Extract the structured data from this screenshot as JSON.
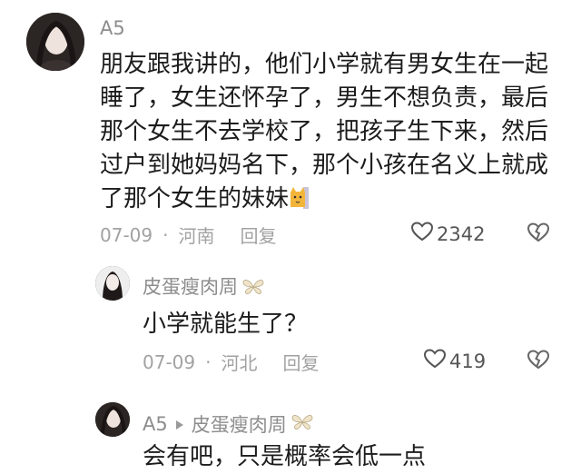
{
  "comments": [
    {
      "username": "A5",
      "text": "朋友跟我讲的，他们小学就有男女生在一起睡了，女生还怀孕了，男生不想负责，最后那个女生不去学校了，把孩子生下来，然后过户到她妈妈名下，那个小孩在名义上就成了那个女生的妹妹",
      "emoji": "cat-emoji",
      "date": "07-09",
      "location": "河南",
      "reply_label": "回复",
      "likes": "2342"
    },
    {
      "username": "皮蛋瘦肉周",
      "text": "小学就能生了？",
      "date": "07-09",
      "location": "河北",
      "reply_label": "回复",
      "likes": "419"
    },
    {
      "username": "A5",
      "reply_to": "皮蛋瘦肉周",
      "text": "会有吧，只是概率会低一点"
    }
  ]
}
